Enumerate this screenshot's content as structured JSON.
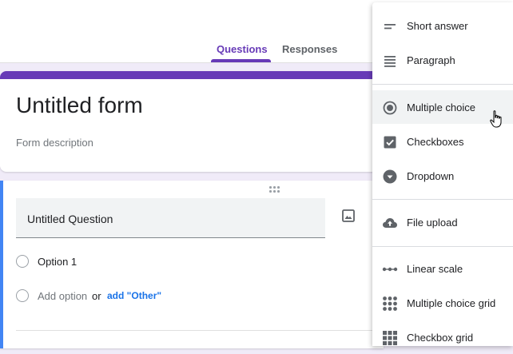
{
  "tabs": [
    {
      "label": "Questions",
      "active": true
    },
    {
      "label": "Responses",
      "active": false
    }
  ],
  "form": {
    "title": "Untitled form",
    "description": "Form description"
  },
  "question": {
    "title": "Untitled Question",
    "options": [
      "Option 1"
    ],
    "add_option": "Add option",
    "or_text": "or",
    "add_other": "add \"Other\""
  },
  "menu": {
    "items": [
      {
        "label": "Short answer",
        "icon": "short-answer-icon"
      },
      {
        "label": "Paragraph",
        "icon": "paragraph-icon"
      },
      {
        "label": "Multiple choice",
        "icon": "radio-icon",
        "hovered": true
      },
      {
        "label": "Checkboxes",
        "icon": "checkbox-icon"
      },
      {
        "label": "Dropdown",
        "icon": "dropdown-icon"
      },
      {
        "label": "File upload",
        "icon": "cloud-upload-icon"
      },
      {
        "label": "Linear scale",
        "icon": "linear-scale-icon"
      },
      {
        "label": "Multiple choice grid",
        "icon": "grid-icon"
      },
      {
        "label": "Checkbox grid",
        "icon": "checkbox-grid-icon"
      }
    ]
  },
  "colors": {
    "accent": "#673ab7",
    "link": "#1a73e8",
    "question_border": "#4285f4",
    "background": "#f0ebf8"
  }
}
